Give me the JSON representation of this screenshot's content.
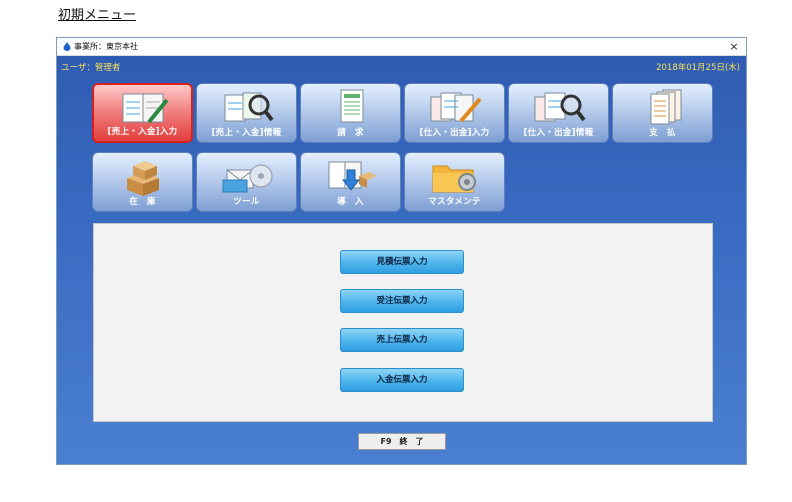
{
  "doc_heading": "初期メニュー",
  "window": {
    "title": "事業所：東京本社",
    "close_glyph": "×"
  },
  "status": {
    "user": "ユーザ：管理者",
    "date": "2018年01月25日(木)"
  },
  "tiles": [
    {
      "label": "[売上・入金]入力",
      "icon": "ledger-pen-icon",
      "active": true
    },
    {
      "label": "[売上・入金]情報",
      "icon": "ledger-magnifier-icon",
      "active": false
    },
    {
      "label": "請　求",
      "icon": "invoice-sheet-icon",
      "active": false
    },
    {
      "label": "[仕入・出金]入力",
      "icon": "ledger-pen-icon",
      "active": false
    },
    {
      "label": "[仕入・出金]情報",
      "icon": "ledger-magnifier-icon",
      "active": false
    },
    {
      "label": "支　払",
      "icon": "payment-sheets-icon",
      "active": false
    },
    {
      "label": "在　庫",
      "icon": "boxes-icon",
      "active": false
    },
    {
      "label": "ツール",
      "icon": "mail-disc-icon",
      "active": false
    },
    {
      "label": "導　入",
      "icon": "import-arrow-icon",
      "active": false
    },
    {
      "label": "マスタメンテ",
      "icon": "folder-gear-icon",
      "active": false
    }
  ],
  "submenu": [
    "見積伝票入力",
    "受注伝票入力",
    "売上伝票入力",
    "入金伝票入力"
  ],
  "exit_button": "F9　終　了",
  "colors": {
    "client_background": "#3a6cc3",
    "status_text": "#f6e05a",
    "active_tile": "#e43f3f",
    "submenu_button": "#4db4ec"
  }
}
